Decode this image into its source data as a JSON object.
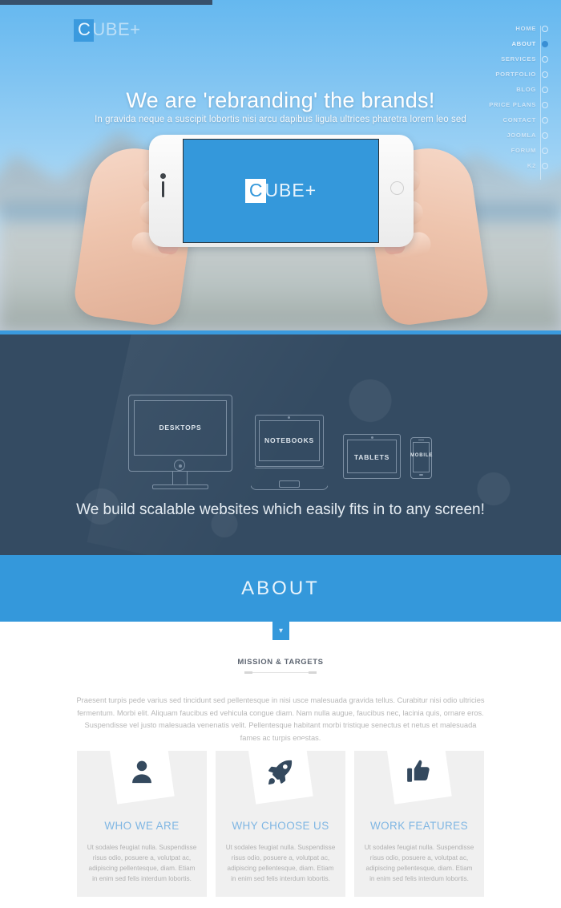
{
  "brand": {
    "logo_boxed": "C",
    "logo_rest": "UBE+",
    "accent_color": "#3498db",
    "dark_color": "#344b62"
  },
  "loading": {
    "progress_label": "38%"
  },
  "nav": {
    "items": [
      {
        "label": "HOME",
        "active": false
      },
      {
        "label": "ABOUT",
        "active": true
      },
      {
        "label": "SERVICES",
        "active": false
      },
      {
        "label": "PORTFOLIO",
        "active": false
      },
      {
        "label": "BLOG",
        "active": false
      },
      {
        "label": "PRICE PLANS",
        "active": false
      },
      {
        "label": "CONTACT",
        "active": false
      },
      {
        "label": "JOOMLA",
        "active": false
      },
      {
        "label": "FORUM",
        "active": false
      },
      {
        "label": "K2",
        "active": false
      }
    ]
  },
  "hero": {
    "title": "We are 'rebranding' the brands!",
    "subtitle": "In gravida neque a suscipit lobortis nisi arcu dapibus ligula ultrices pharetra lorem leo sed",
    "phone_screen_logo_boxed": "C",
    "phone_screen_logo_rest": "UBE+"
  },
  "devices": {
    "items": [
      {
        "label": "DESKTOPS"
      },
      {
        "label": "NOTEBOOKS"
      },
      {
        "label": "TABLETS"
      },
      {
        "label": "MOBILE"
      }
    ],
    "tagline": "We build scalable websites which easily fits in to any screen!"
  },
  "about": {
    "band_title": "ABOUT",
    "scroll_tab_icon": "chevron-down",
    "section_heading": "MISSION & TARGETS",
    "body": "Praesent turpis pede varius sed tincidunt sed pellentesque in nisi usce malesuada gravida tellus. Curabitur nisi odio ultricies fermentum. Morbi elit. Aliquam faucibus ed vehicula congue diam. Nam nulla augue, faucibus nec, lacinia quis, ornare eros. Suspendisse vel justo malesuada venenatis velit. Pellentesque habitant morbi tristique senectus et netus et malesuada fames ac turpis egestas.",
    "cards": [
      {
        "icon": "user-icon",
        "title": "WHO WE ARE",
        "text": "Ut sodales feugiat nulla. Suspendisse risus odio, posuere a, volutpat ac, adipiscing pellentesque, diam. Etiam in enim sed felis interdum lobortis."
      },
      {
        "icon": "rocket-icon",
        "title": "WHY CHOOSE US",
        "text": "Ut sodales feugiat nulla. Suspendisse risus odio, posuere a, volutpat ac, adipiscing pellentesque, diam. Etiam in enim sed felis interdum lobortis."
      },
      {
        "icon": "thumbs-up-icon",
        "title": "WORK FEATURES",
        "text": "Ut sodales feugiat nulla. Suspendisse risus odio, posuere a, volutpat ac, adipiscing pellentesque, diam. Etiam in enim sed felis interdum lobortis."
      }
    ]
  }
}
